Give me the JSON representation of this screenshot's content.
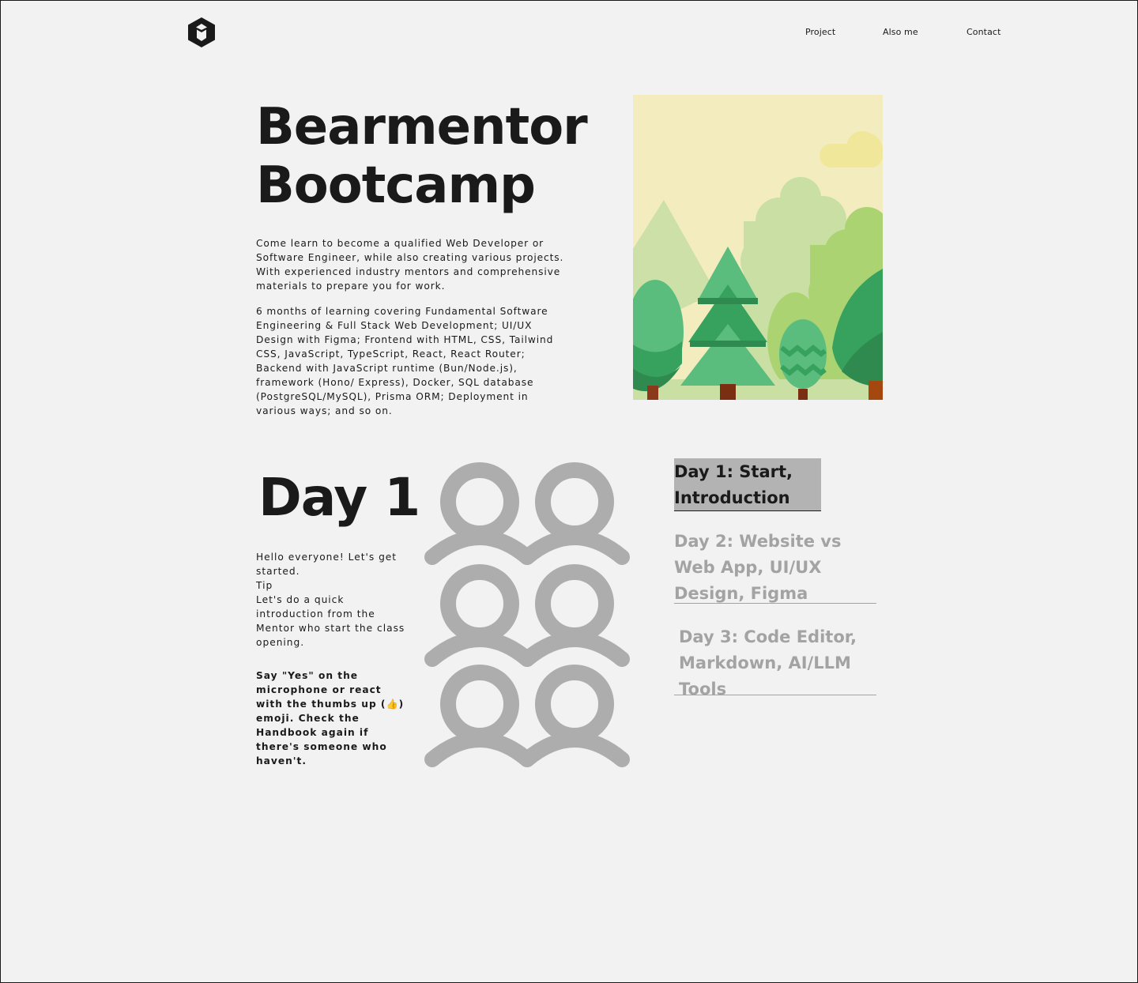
{
  "nav": {
    "items": [
      {
        "label": "Project"
      },
      {
        "label": "Also me"
      },
      {
        "label": "Contact"
      }
    ]
  },
  "hero": {
    "title_line1": "Bearmentor",
    "title_line2": "Bootcamp",
    "paragraph1": "Come learn to become a qualified Web Developer or Software Engineer, while also creating various projects. With experienced industry mentors and comprehensive materials to prepare you for work.",
    "paragraph2": "6 months of learning covering Fundamental Software Engineering & Full Stack Web Development; UI/UX Design with Figma; Frontend with HTML, CSS, Tailwind CSS, JavaScript, TypeScript, React, React Router; Backend with JavaScript runtime (Bun/Node.js), framework (Hono/ Express), Docker, SQL database (PostgreSQL/MySQL), Prisma ORM; Deployment in various ways; and so on."
  },
  "day": {
    "title": "Day 1",
    "intro": {
      "line1": "Hello everyone! Let's get started.",
      "tip": "Tip",
      "tip_text": "Let's do a quick introduction from the Mentor who start the class opening."
    },
    "instruction": "Say \"Yes\" on the microphone or react with the thumbs up (👍) emoji. Check the Handbook again if there's someone who haven't."
  },
  "day_list": [
    {
      "label": "Day 1:  Start, Introduction",
      "active": true
    },
    {
      "label": "Day 2: Website vs Web App, UI/UX Design, Figma",
      "active": false
    },
    {
      "label": "Day 3: Code Editor, Markdown, AI/LLM Tools",
      "active": false
    }
  ],
  "colors": {
    "background": "#f2f2f2",
    "text": "#1a1a1a",
    "muted": "#a3a3a3",
    "active_bg": "#b3b3b3",
    "icon_gray": "#adadad"
  },
  "icons": {
    "logo": "hexagon-logo-icon",
    "people": "users-group-icon"
  }
}
